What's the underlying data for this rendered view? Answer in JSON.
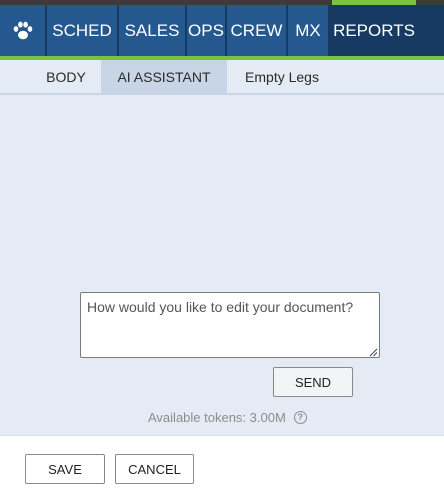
{
  "nav": {
    "items": [
      {
        "label": "SCHED"
      },
      {
        "label": "SALES"
      },
      {
        "label": "OPS"
      },
      {
        "label": "CREW"
      },
      {
        "label": "MX"
      },
      {
        "label": "REPORTS"
      }
    ],
    "logo_icon": "paw-icon",
    "active": "REPORTS"
  },
  "subtabs": {
    "items": [
      {
        "label": "BODY"
      },
      {
        "label": "AI ASSISTANT"
      },
      {
        "label": "Empty Legs"
      }
    ],
    "active": "AI ASSISTANT"
  },
  "assistant": {
    "placeholder": "How would you like to edit your document?",
    "send_label": "SEND",
    "tokens_text": "Available tokens: 3.00M",
    "help_icon": "question-circle-icon",
    "help_glyph": "?"
  },
  "footer": {
    "save_label": "SAVE",
    "cancel_label": "CANCEL"
  },
  "colors": {
    "nav_bg": "#173a63",
    "nav_item": "#24588f",
    "accent": "#7cc242",
    "panel_bg": "#e4ebf4",
    "active_subtab": "#c7d5e7"
  }
}
